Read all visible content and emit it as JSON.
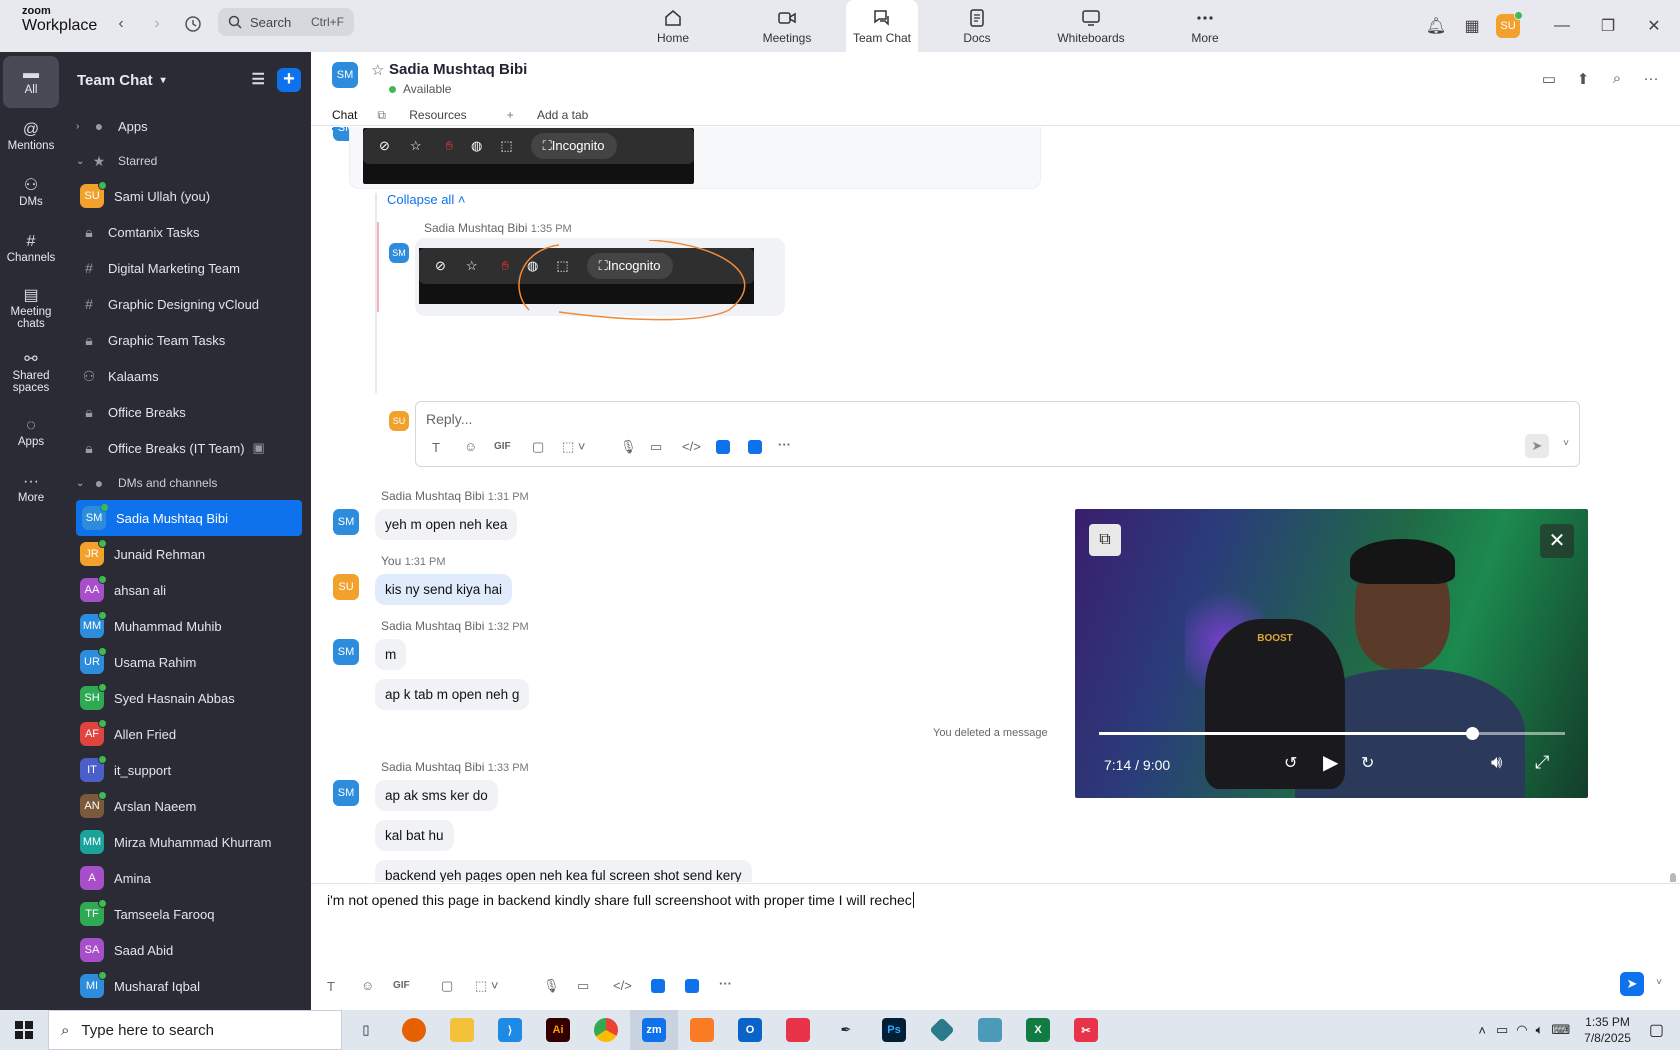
{
  "app": {
    "brand_small": "zoom",
    "brand": "Workplace",
    "search_placeholder": "Search",
    "search_shortcut": "Ctrl+F"
  },
  "top_tabs": [
    {
      "label": "Home"
    },
    {
      "label": "Meetings"
    },
    {
      "label": "Team Chat"
    },
    {
      "label": "Docs"
    },
    {
      "label": "Whiteboards"
    },
    {
      "label": "More"
    }
  ],
  "user_initials": "SU",
  "rail": [
    {
      "label": "All"
    },
    {
      "label": "Mentions"
    },
    {
      "label": "DMs"
    },
    {
      "label": "Channels"
    },
    {
      "label": "Meeting chats"
    },
    {
      "label": "Shared spaces"
    },
    {
      "label": "Apps"
    },
    {
      "label": "More"
    }
  ],
  "sidebar": {
    "title": "Team Chat",
    "apps": "Apps",
    "starred": "Starred",
    "dms_section": "DMs and channels",
    "starred_items": [
      {
        "label": "Sami Ullah (you)",
        "initials": "SU",
        "color": "#f2a12d"
      },
      {
        "label": "Comtanix Tasks"
      },
      {
        "label": "Digital Marketing Team"
      },
      {
        "label": "Graphic Designing vCloud"
      },
      {
        "label": "Graphic Team Tasks"
      },
      {
        "label": "Kalaams"
      },
      {
        "label": "Office Breaks"
      },
      {
        "label": "Office Breaks (IT Team)"
      }
    ],
    "dm_items": [
      {
        "label": "Sadia Mushtaq Bibi",
        "initials": "SM",
        "color": "#2d8cdc"
      },
      {
        "label": "Junaid Rehman",
        "initials": "JR",
        "color": "#f2a12d"
      },
      {
        "label": "ahsan ali",
        "initials": "AA",
        "color": "#a64fc9"
      },
      {
        "label": "Muhammad Muhib",
        "initials": "MM",
        "color": "#2d8cdc"
      },
      {
        "label": "Usama Rahim",
        "initials": "UR",
        "color": "#2d8cdc"
      },
      {
        "label": "Syed Hasnain Abbas",
        "initials": "SH",
        "color": "#2eaa55"
      },
      {
        "label": "Allen Fried",
        "initials": "AF",
        "color": "#e0443e"
      },
      {
        "label": "it_support",
        "initials": "IT",
        "color": "#4b5fc9"
      },
      {
        "label": "Arslan Naeem",
        "initials": "AN",
        "color": "#7a5a3a"
      },
      {
        "label": "Mirza Muhammad Khurram",
        "initials": "MM",
        "color": "#1aa39a"
      },
      {
        "label": "Amina",
        "initials": "A",
        "color": "#a64fc9"
      },
      {
        "label": "Tamseela Farooq",
        "initials": "TF",
        "color": "#2eaa55"
      },
      {
        "label": "Saad Abid",
        "initials": "SA",
        "color": "#a64fc9"
      },
      {
        "label": "Musharaf Iqbal",
        "initials": "MI",
        "color": "#2d8cdc"
      }
    ]
  },
  "chat": {
    "name": "Sadia Mushtaq Bibi",
    "initials": "SM",
    "status": "Available",
    "tabs": [
      "Chat",
      "Resources",
      "Add a tab"
    ],
    "collapse": "Collapse all",
    "thread_sender": "Sadia Mushtaq Bibi",
    "thread_time": "1:35 PM",
    "incognito": "Incognito",
    "reply_placeholder": "Reply...",
    "m1_sender": "Sadia Mushtaq Bibi",
    "m1_time": "1:31 PM",
    "m1": "yeh m open neh kea",
    "m2_sender": "You",
    "m2_time": "1:31 PM",
    "m2": "kis ny send kiya hai",
    "m3_sender": "Sadia Mushtaq Bibi",
    "m3_time": "1:32 PM",
    "m3a": "m",
    "m3b": "ap k tab m open neh g",
    "deleted": "You deleted a message",
    "m4_sender": "Sadia Mushtaq Bibi",
    "m4_time": "1:33 PM",
    "m4a": "ap ak sms ker do",
    "m4b": "kal bat hu",
    "m4c": "backend yeh pages open neh kea ful screen shot send kery",
    "composer_text": "i'm not opened this page in backend kindly share full screenshoot with proper time I will rechec"
  },
  "video": {
    "time": "7:14 / 9:00",
    "progress": 0.8,
    "shirt_text": "BOOST"
  },
  "taskbar": {
    "search_placeholder": "Type here to search",
    "time": "1:35 PM",
    "date": "7/8/2025"
  }
}
